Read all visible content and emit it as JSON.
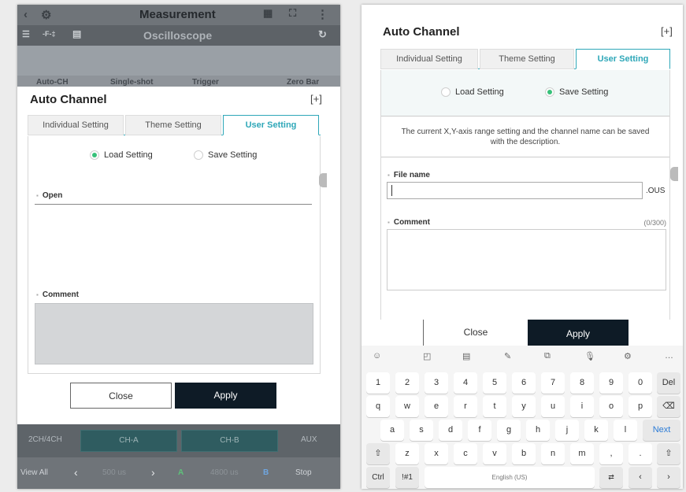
{
  "left": {
    "appbar": {
      "title": "Measurement",
      "subtitle": "Oscilloscope"
    },
    "top_buttons": [
      "Auto-CH",
      "Single-shot",
      "Trigger",
      "Zero Bar"
    ],
    "dialog": {
      "title": "Auto Channel",
      "tabs": [
        "Individual Setting",
        "Theme Setting",
        "User Setting"
      ],
      "radio_load": "Load Setting",
      "radio_save": "Save Setting",
      "open_label": "Open",
      "comment_label": "Comment"
    },
    "footer": {
      "close": "Close",
      "apply": "Apply"
    },
    "bottom": {
      "row1": [
        "2CH/4CH",
        "CH-A",
        "CH-B",
        "AUX"
      ],
      "row2": [
        "View All",
        "500 us",
        "A",
        "4800 us",
        "B",
        "Stop"
      ]
    }
  },
  "right": {
    "dialog": {
      "title": "Auto Channel",
      "tabs": [
        "Individual Setting",
        "Theme Setting",
        "User Setting"
      ],
      "radio_load": "Load Setting",
      "radio_save": "Save Setting",
      "description_line1": "The current X,Y-axis range setting and the channel name can be saved",
      "description_line2": "with the description.",
      "file_name_label": "File name",
      "file_ext": ".OUS",
      "comment_label": "Comment",
      "comment_count": "(0/300)"
    },
    "footer": {
      "close": "Close",
      "apply": "Apply"
    },
    "keyboard": {
      "row_numbers": [
        "1",
        "2",
        "3",
        "4",
        "5",
        "6",
        "7",
        "8",
        "9",
        "0",
        "Del"
      ],
      "row_q": [
        "q",
        "w",
        "e",
        "r",
        "t",
        "y",
        "u",
        "i",
        "o",
        "p"
      ],
      "row_a": [
        "a",
        "s",
        "d",
        "f",
        "g",
        "h",
        "j",
        "k",
        "l",
        "Next"
      ],
      "row_z": [
        "z",
        "x",
        "c",
        "v",
        "b",
        "n",
        "m"
      ],
      "row_bottom": [
        "Ctrl",
        "!#1",
        "English (US)"
      ]
    }
  }
}
